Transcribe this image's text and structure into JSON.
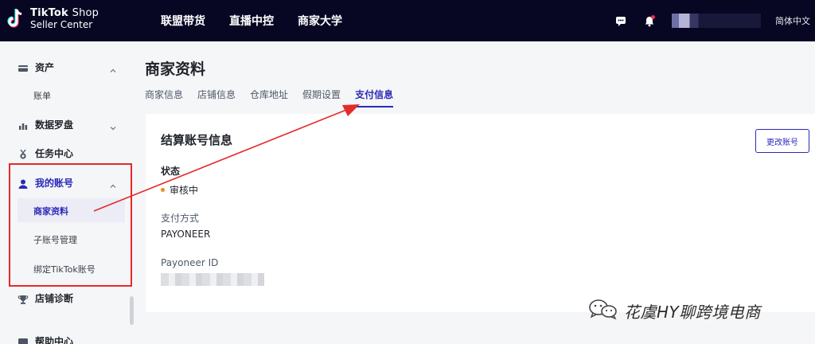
{
  "brand": {
    "line1": "TikTok",
    "line1_suffix": "Shop",
    "line2": "Seller Center"
  },
  "nav": {
    "items": [
      "联盟带货",
      "直播中控",
      "商家大学"
    ]
  },
  "topright": {
    "language": "简体中文",
    "chat_icon": "chat-icon",
    "bell_icon": "bell-icon"
  },
  "sidebar": {
    "groups": [
      {
        "label": "资产",
        "icon": "card-icon",
        "subs": [
          "账单"
        ]
      },
      {
        "label": "数据罗盘",
        "icon": "bar-chart-icon"
      },
      {
        "label": "任务中心",
        "icon": "medal-icon"
      },
      {
        "label": "我的账号",
        "icon": "user-icon",
        "subs": [
          "商家资料",
          "子账号管理",
          "绑定TikTok账号"
        ]
      },
      {
        "label": "店铺诊断",
        "icon": "trophy-icon"
      },
      {
        "label": "帮助中心",
        "icon": "help-icon"
      }
    ]
  },
  "page": {
    "title": "商家资料",
    "tabs": [
      "商家信息",
      "店铺信息",
      "仓库地址",
      "假期设置",
      "支付信息"
    ],
    "active_tab": "支付信息"
  },
  "card": {
    "title": "结算账号信息",
    "change_button": "更改账号",
    "status_label": "状态",
    "status_value": "审核中",
    "payment_label": "支付方式",
    "payment_value": "PAYONEER",
    "id_label": "Payoneer ID"
  },
  "watermark": {
    "text": "花虞HY聊跨境电商"
  },
  "colors": {
    "topbar": "#070723",
    "accent": "#2a2ab8",
    "highlight": "#e52a2a",
    "status_dot": "#f08c1a"
  }
}
